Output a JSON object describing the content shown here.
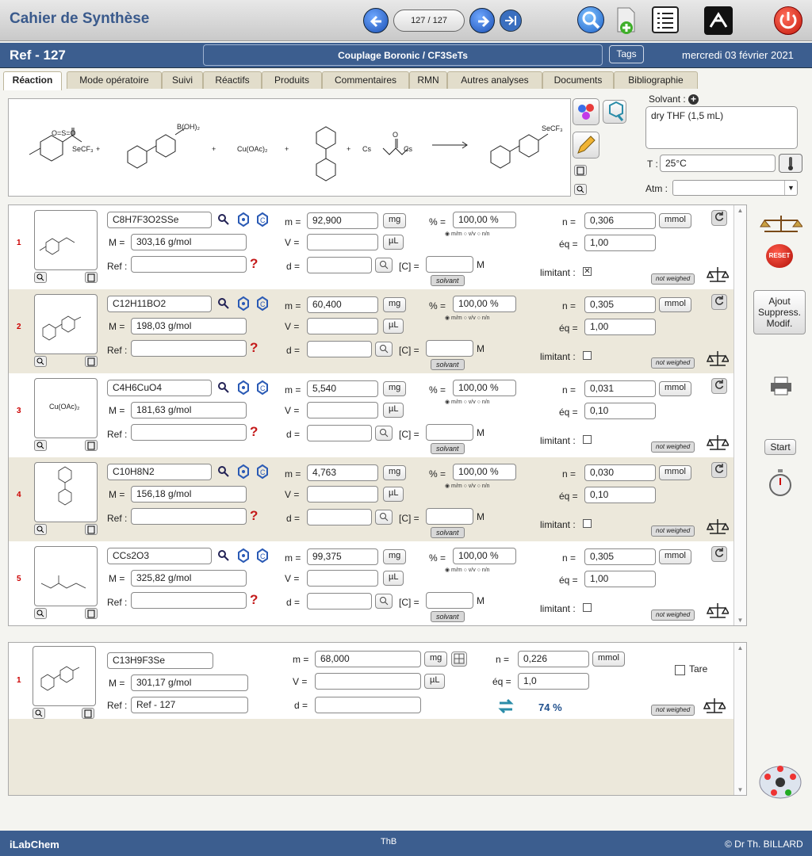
{
  "app_title": "Cahier de Synthèse",
  "page_counter": "127 / 127",
  "ref": "Ref - 127",
  "reaction_title": "Couplage Boronic / CF3SeTs",
  "tags_label": "Tags",
  "date": "mercredi 03 février 2021",
  "tabs": [
    "Réaction",
    "Mode opératoire",
    "Suivi",
    "Réactifs",
    "Produits",
    "Commentaires",
    "RMN",
    "Autres analyses",
    "Documents",
    "Bibliographie"
  ],
  "scheme": {
    "so2": "O=S=O",
    "secf3": "SeCF₃",
    "boh2": "B(OH)₂",
    "cuoac": "Cu(OAc)₂",
    "cs1": "Cs",
    "cs2": "Cs",
    "o": "O",
    "plus": "+",
    "product_secf3": "SeCF₃"
  },
  "solvent": {
    "label": "Solvant :",
    "value": "dry THF (1,5 mL)"
  },
  "temperature": {
    "label": "T :",
    "value": "25°C"
  },
  "atmosphere": {
    "label": "Atm :",
    "value": ""
  },
  "labels": {
    "m": "m =",
    "M": "M =",
    "V": "V =",
    "d": "d =",
    "ref": "Ref :",
    "pct": "% =",
    "n": "n =",
    "eq": "éq =",
    "conc": "[C] =",
    "conc_unit": "M",
    "limitant": "limitant :",
    "mg": "mg",
    "ul": "µL",
    "mmol": "mmol",
    "solvent_btn": "solvant",
    "not_weighed": "not weighed",
    "radios": "◉ m/m  ○ v/v  ○ n/n",
    "qmark": "?",
    "check": "✕",
    "tare": "Tare"
  },
  "reagents": [
    {
      "num": "1",
      "formula": "C8H7F3O2SSe",
      "M": "303,16 g/mol",
      "m": "92,900",
      "pct": "100,00 %",
      "n": "0,306",
      "eq": "1,00",
      "limitant": true,
      "thumb": ""
    },
    {
      "num": "2",
      "formula": "C12H11BO2",
      "M": "198,03 g/mol",
      "m": "60,400",
      "pct": "100,00 %",
      "n": "0,305",
      "eq": "1,00",
      "limitant": false,
      "thumb": ""
    },
    {
      "num": "3",
      "formula": "C4H6CuO4",
      "M": "181,63 g/mol",
      "m": "5,540",
      "pct": "100,00 %",
      "n": "0,031",
      "eq": "0,10",
      "limitant": false,
      "thumb": "Cu(OAc)₂"
    },
    {
      "num": "4",
      "formula": "C10H8N2",
      "M": "156,18 g/mol",
      "m": "4,763",
      "pct": "100,00 %",
      "n": "0,030",
      "eq": "0,10",
      "limitant": false,
      "thumb": ""
    },
    {
      "num": "5",
      "formula": "CCs2O3",
      "M": "325,82 g/mol",
      "m": "99,375",
      "pct": "100,00 %",
      "n": "0,305",
      "eq": "1,00",
      "limitant": false,
      "thumb": ""
    }
  ],
  "product": {
    "num": "1",
    "formula": "C13H9F3Se",
    "M": "301,17 g/mol",
    "ref": "Ref - 127",
    "m": "68,000",
    "n": "0,226",
    "eq": "1,0",
    "yield": "74 %"
  },
  "side": {
    "modif": "Ajout\nSuppress.\nModif.",
    "start": "Start",
    "reset": "RESET"
  },
  "footer": {
    "left": "iLabChem",
    "mid": "ThB",
    "right": "© Dr Th. BILLARD"
  },
  "colors": {
    "accent": "#3c5e8f",
    "alt_row": "#ece8db",
    "danger": "#c41a1a"
  }
}
